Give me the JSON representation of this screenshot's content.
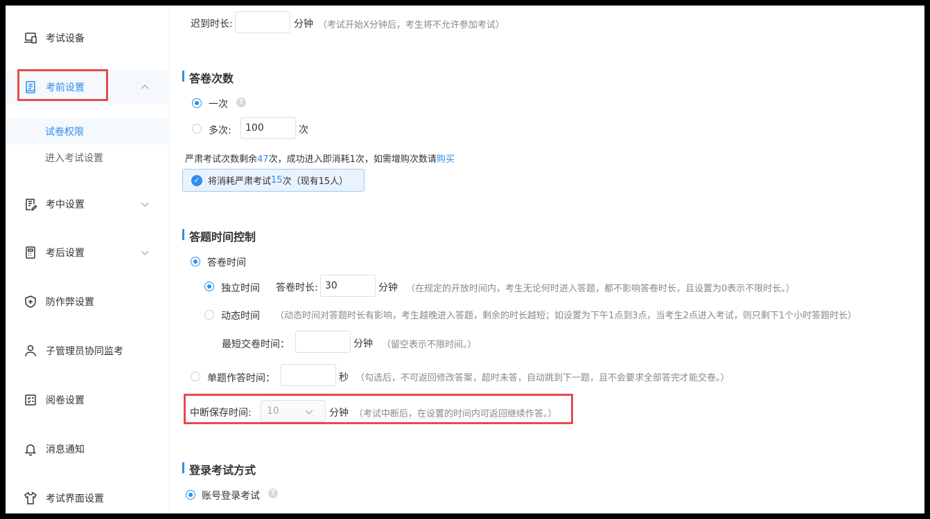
{
  "sidebar": {
    "items": [
      {
        "label": "考试设备",
        "icon": "laptop-icon"
      },
      {
        "label": "考前设置",
        "icon": "document-icon"
      },
      {
        "label": "考中设置",
        "icon": "edit-doc-icon"
      },
      {
        "label": "考后设置",
        "icon": "calculator-icon"
      },
      {
        "label": "防作弊设置",
        "icon": "shield-plus-icon"
      },
      {
        "label": "子管理员协同监考",
        "icon": "user-icon"
      },
      {
        "label": "阅卷设置",
        "icon": "checklist-icon"
      },
      {
        "label": "消息通知",
        "icon": "bell-icon"
      },
      {
        "label": "考试界面设置",
        "icon": "shirt-icon"
      }
    ],
    "sub_items": [
      {
        "label": "试卷权限"
      },
      {
        "label": "进入考试设置"
      }
    ]
  },
  "late": {
    "label": "迟到时长:",
    "value": "",
    "unit": "分钟",
    "hint": "（考试开始X分钟后，考生将不允许参加考试）"
  },
  "attempts": {
    "title": "答卷次数",
    "once_label": "一次",
    "multi_label": "多次:",
    "multi_value": "100",
    "multi_unit": "次",
    "remain_prefix": "严肃考试次数剩余",
    "remain_count": "47",
    "remain_suffix": "次，成功进入即消耗1次，如需增购次数请",
    "buy_link": "购买",
    "notice_prefix": "将消耗严肃考试",
    "notice_count": "15",
    "notice_suffix": "次（现有15人）"
  },
  "time_control": {
    "title": "答题时间控制",
    "paper_time_label": "答卷时间",
    "independent_label": "独立时间",
    "duration_label": "答卷时长:",
    "duration_value": "30",
    "duration_unit": "分钟",
    "independent_hint": "（在规定的开放时间内，考生无论何时进入答题，都不影响答卷时长，且设置为0表示不限时长。）",
    "dynamic_label": "动态时间",
    "dynamic_hint": "（动态时间对答题时长有影响，考生越晚进入答题，剩余的时长越短；如设置为下午1点到3点，当考生2点进入考试，则只剩下1个小时答题时长）",
    "min_submit_label": "最短交卷时间：",
    "min_submit_value": "",
    "min_submit_unit": "分钟",
    "min_submit_hint": "（留空表示不限时间。）",
    "single_label": "单题作答时间：",
    "single_value": "",
    "single_unit": "秒",
    "single_hint": "（勾选后，不可返回修改答案，超时未答，自动跳到下一题，且不会要求全部答完才能交卷。）",
    "interrupt_label": "中断保存时间:",
    "interrupt_value": "10",
    "interrupt_unit": "分钟",
    "interrupt_hint": "（考试中断后，在设置的时间内可返回继续作答。）"
  },
  "login": {
    "title": "登录考试方式",
    "account_label": "账号登录考试"
  },
  "colors": {
    "accent": "#2e8cf0",
    "highlight_border": "#e34c4c"
  }
}
